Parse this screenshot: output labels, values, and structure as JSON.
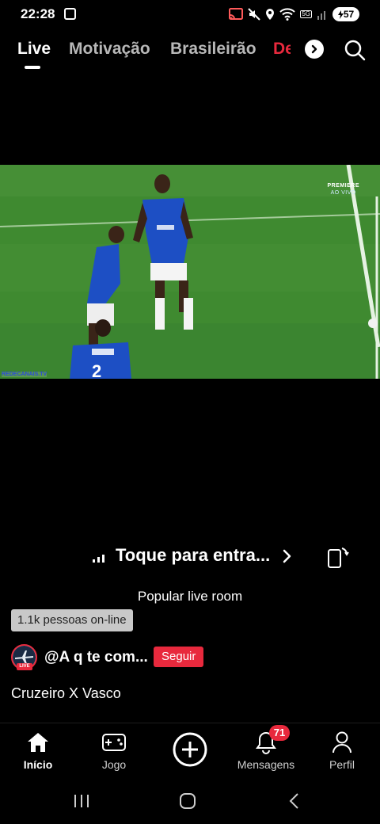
{
  "status_bar": {
    "time": "22:28",
    "network_label": "5G",
    "battery": "57"
  },
  "tabs": [
    {
      "label": "Live",
      "active": true
    },
    {
      "label": "Motivação",
      "active": false
    },
    {
      "label": "Brasileirão",
      "active": false
    },
    {
      "label": "De",
      "active": false,
      "color": "#e8293d"
    }
  ],
  "video": {
    "broadcaster": "PREMIERE",
    "broadcaster_sub": "AO VIVO",
    "watermark": "REDECANAIS.TV",
    "player_numbers": [
      "2"
    ]
  },
  "enter_prompt": "Toque para entra...",
  "room_label": "Popular live room",
  "online_count": "1.1k pessoas on-line",
  "creator": {
    "name": "@A q te com...",
    "avatar_badge": "LIVE",
    "follow_label": "Seguir"
  },
  "live_title": "Cruzeiro X Vasco",
  "bottom_nav": [
    {
      "label": "Início",
      "icon": "home-icon",
      "active": true
    },
    {
      "label": "Jogo",
      "icon": "gamepad-icon",
      "active": false
    },
    {
      "label": "",
      "icon": "create-plus-icon",
      "active": false
    },
    {
      "label": "Mensagens",
      "icon": "bell-icon",
      "active": false,
      "badge": "71"
    },
    {
      "label": "Perfil",
      "icon": "profile-icon",
      "active": false
    }
  ],
  "colors": {
    "accent": "#e8293d",
    "background": "#000000",
    "pitch": "#3f8a30",
    "jersey": "#1d4fc4"
  }
}
